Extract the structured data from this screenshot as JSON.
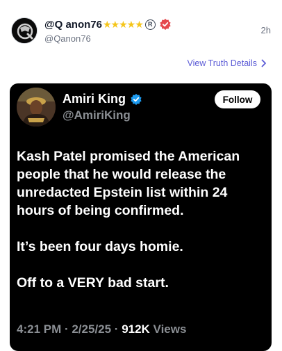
{
  "post": {
    "display_name": "@Q anon76",
    "stars": "★★★★★",
    "registered_mark": "R",
    "handle": "@Qanon76",
    "time": "2h",
    "details_link": "View Truth Details"
  },
  "embed": {
    "name": "Amiri King",
    "handle": "@AmiriKing",
    "follow_label": "Follow",
    "paragraphs": [
      "Kash Patel promised the American people that he would release the unredacted Epstein list within 24 hours of being confirmed.",
      "It’s been four days homie.",
      "Off to a VERY bad start."
    ],
    "meta_prefix": "4:21 PM · 2/25/25 · ",
    "views_count": "912K",
    "views_label": " Views"
  },
  "colors": {
    "accent_link": "#5b5bd6",
    "verified_red": "#e5484d",
    "verified_blue": "#1d9bf0",
    "star_gold": "#f5c518"
  }
}
